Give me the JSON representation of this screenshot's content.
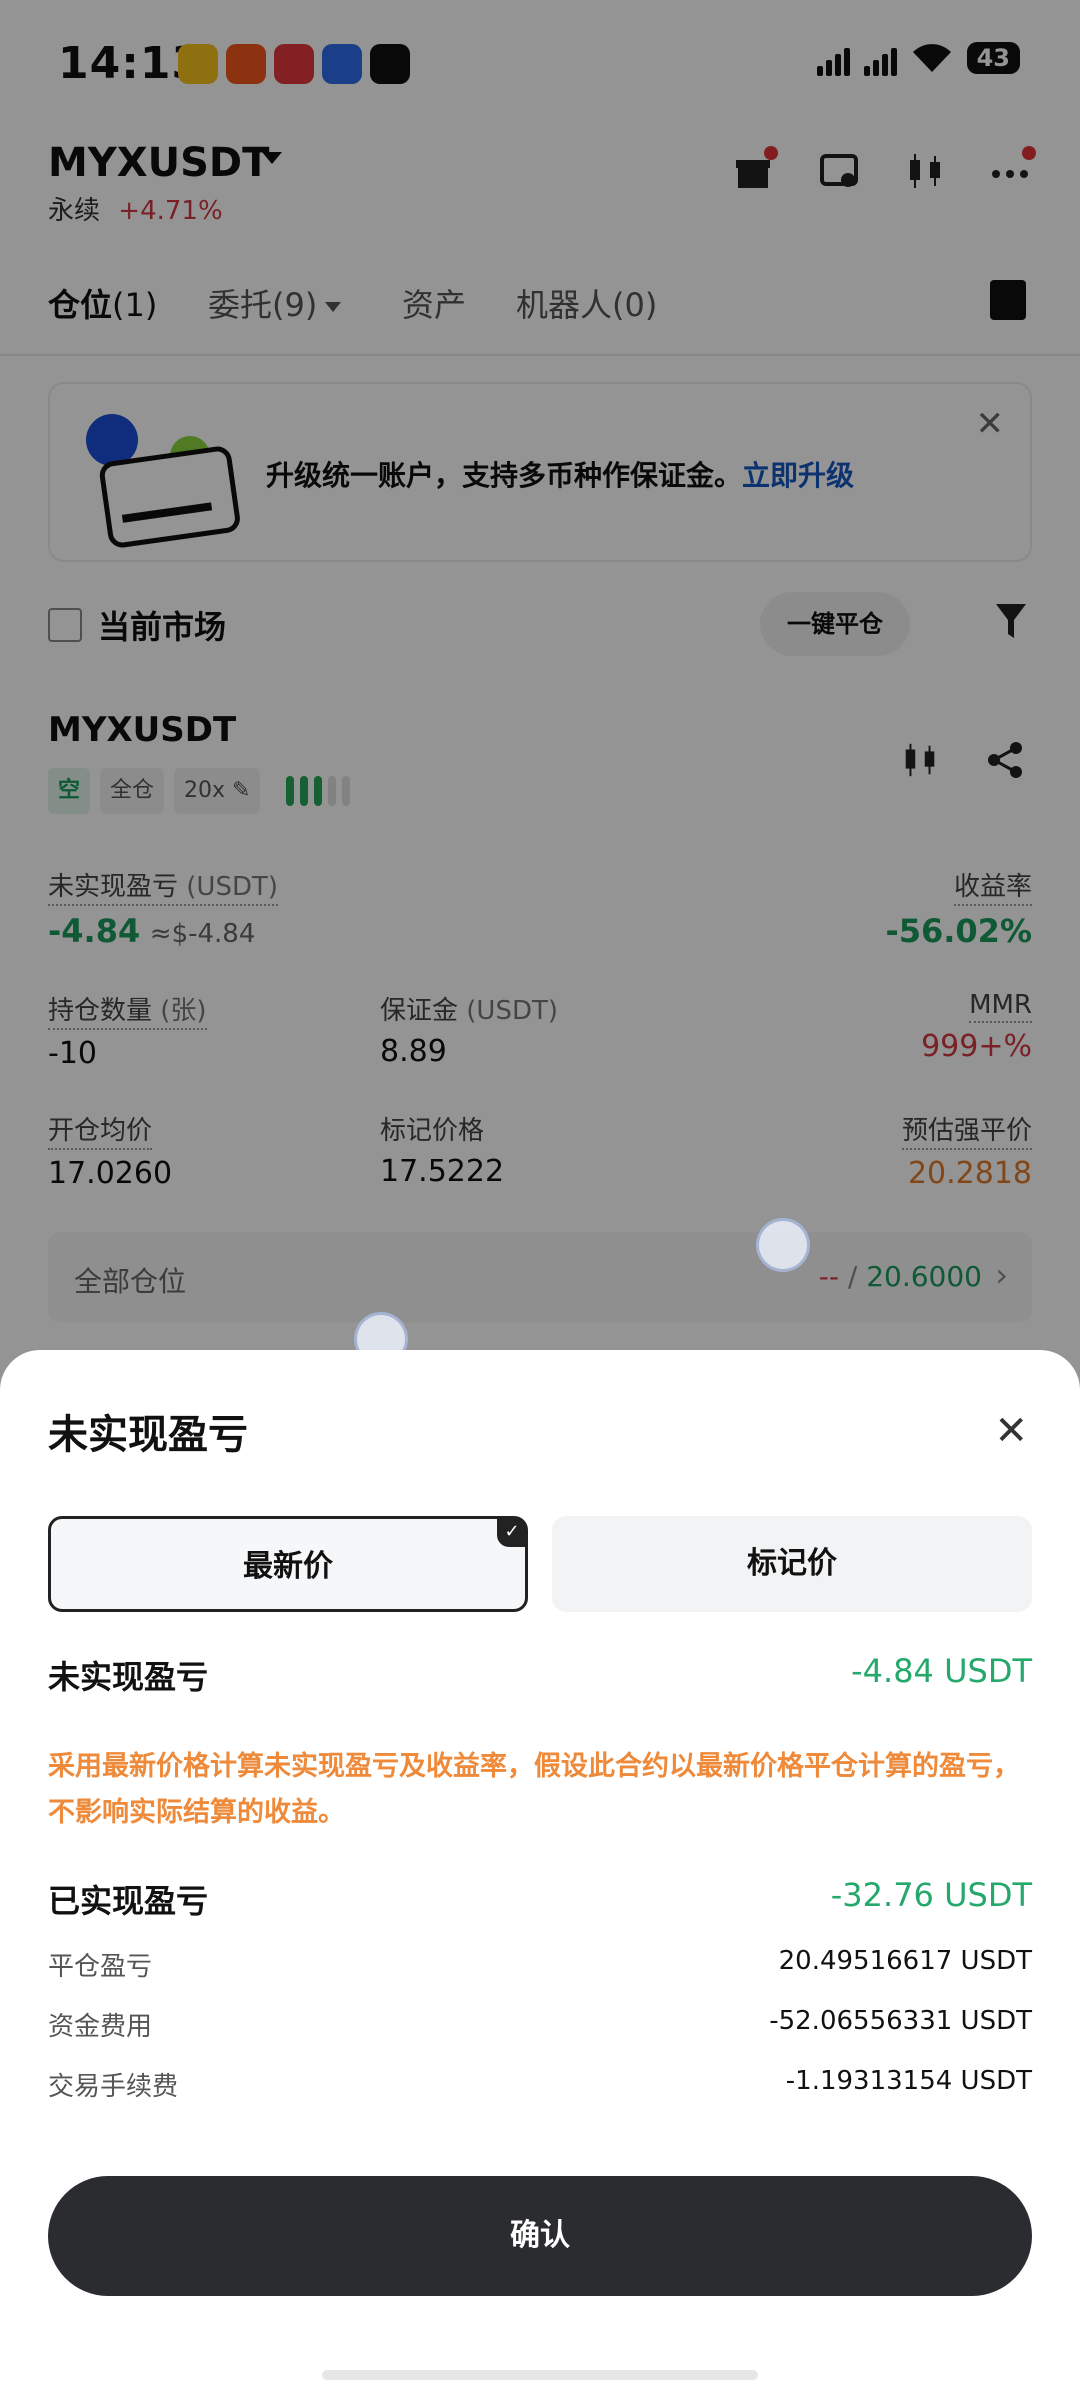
{
  "status_bar": {
    "time": "14:13",
    "network1": "5G",
    "network2": "5G",
    "battery": "43"
  },
  "header": {
    "pair": "MYXUSDT",
    "type": "永续",
    "change": "+4.71%"
  },
  "tabs": [
    {
      "label": "仓位",
      "count": "(1)"
    },
    {
      "label": "委托",
      "count": "(9)"
    },
    {
      "label": "资产",
      "count": ""
    },
    {
      "label": "机器人",
      "count": "(0)"
    }
  ],
  "banner": {
    "text": "升级统一账户，支持多币种作保证金。",
    "link": "立即升级"
  },
  "filter": {
    "current_market": "当前市场",
    "close_all": "一键平仓"
  },
  "position": {
    "symbol": "MYXUSDT",
    "side": "空",
    "margin_mode": "全仓",
    "leverage": "20x",
    "unrealized_label": "未实现盈亏",
    "unrealized_unit": "(USDT)",
    "unrealized_value": "-4.84",
    "unrealized_approx": "≈$-4.84",
    "roi_label": "收益率",
    "roi_value": "-56.02%",
    "qty_label": "持仓数量",
    "qty_unit": "(张)",
    "qty_value": "-10",
    "margin_label": "保证金",
    "margin_unit": "(USDT)",
    "margin_value": "8.89",
    "mmr_label": "MMR",
    "mmr_value": "999+%",
    "entry_label": "开仓均价",
    "entry_value": "17.0260",
    "mark_label": "标记价格",
    "mark_value": "17.5222",
    "liq_label": "预估强平价",
    "liq_value": "20.2818",
    "all_positions": "全部仓位",
    "tp_sl_left": "--",
    "tp_sl_sep": " / ",
    "tp_sl_right": "20.6000"
  },
  "sheet": {
    "title": "未实现盈亏",
    "tab_latest": "最新价",
    "tab_mark": "标记价",
    "unrealized_label": "未实现盈亏",
    "unrealized_value": "-4.84 USDT",
    "note": "采用最新价格计算未实现盈亏及收益率，假设此合约以最新价格平仓计算的盈亏，不影响实际结算的收益。",
    "realized_label": "已实现盈亏",
    "realized_value": "-32.76 USDT",
    "items": [
      {
        "label": "平仓盈亏",
        "value": "20.49516617 USDT"
      },
      {
        "label": "资金费用",
        "value": "-52.06556331 USDT"
      },
      {
        "label": "交易手续费",
        "value": "-1.19313154 USDT"
      }
    ],
    "confirm": "确认"
  },
  "colors": {
    "green": "#1a9a5c",
    "red": "#d23a45",
    "orange": "#e07a2a",
    "link": "#1557c2"
  }
}
